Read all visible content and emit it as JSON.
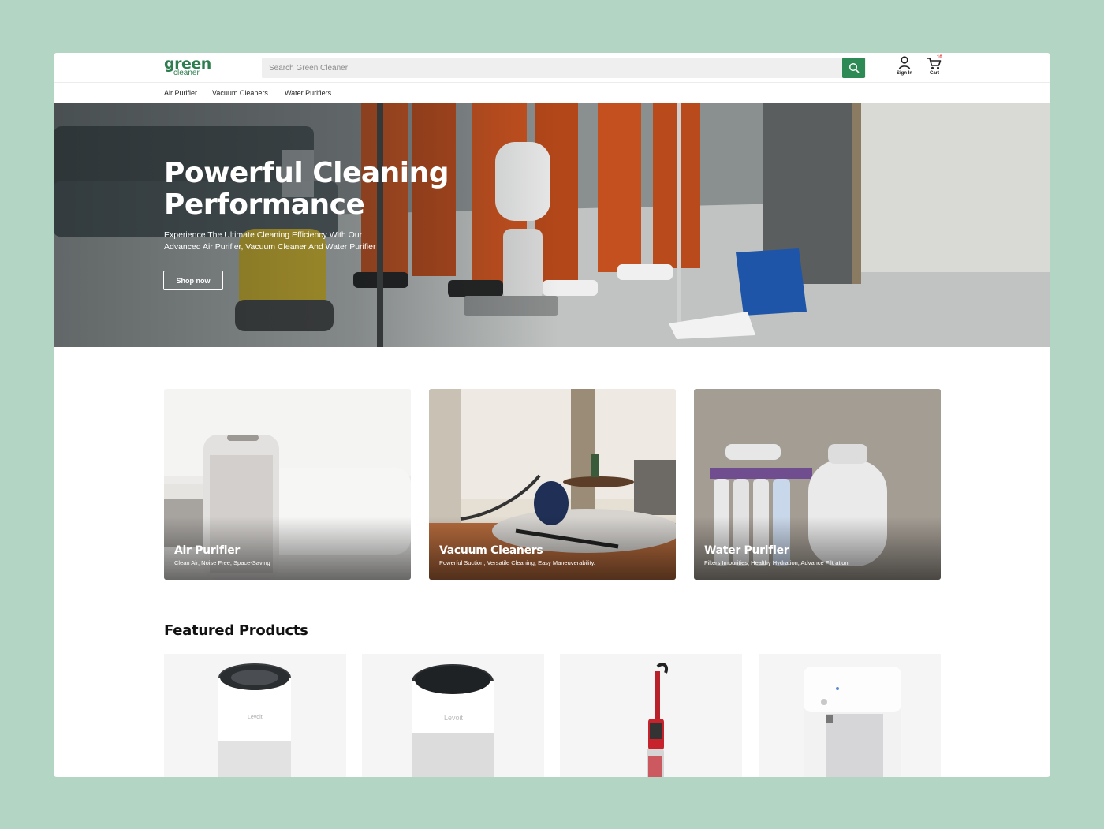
{
  "brand": {
    "name": "green",
    "sub": "cleaner"
  },
  "search": {
    "placeholder": "Search Green Cleaner"
  },
  "header": {
    "signin_label": "Sign In",
    "cart_label": "Cart",
    "cart_count": "10"
  },
  "nav": {
    "items": [
      {
        "label": "Air Purifier"
      },
      {
        "label": "Vacuum Cleaners"
      },
      {
        "label": "Water Purifiers"
      }
    ]
  },
  "hero": {
    "title": "Powerful Cleaning Performance",
    "subtitle": "Experience The Ultimate Cleaning Efficiency With Our Advanced Air Purifier, Vacuum Cleaner And Water Purifier",
    "cta": "Shop now"
  },
  "categories": [
    {
      "title": "Air Purifier",
      "desc": "Clean Air, Noise Free, Space-Saving"
    },
    {
      "title": "Vacuum Cleaners",
      "desc": "Powerful Suction, Versatile Cleaning, Easy Maneuverability."
    },
    {
      "title": "Water Purifier",
      "desc": "Filters Impurities, Healthy Hydration, Advance Filtration"
    }
  ],
  "featured": {
    "title": "Featured Products",
    "products": [
      {
        "brand_mark": "Levoit"
      },
      {
        "brand_mark": "Levoit"
      },
      {
        "brand_mark": ""
      },
      {
        "brand_mark": ""
      }
    ]
  },
  "colors": {
    "brand_green": "#2e7d4f",
    "button_green": "#2e8a54",
    "page_bg": "#b3d5c3",
    "badge_red": "#e0262b"
  }
}
